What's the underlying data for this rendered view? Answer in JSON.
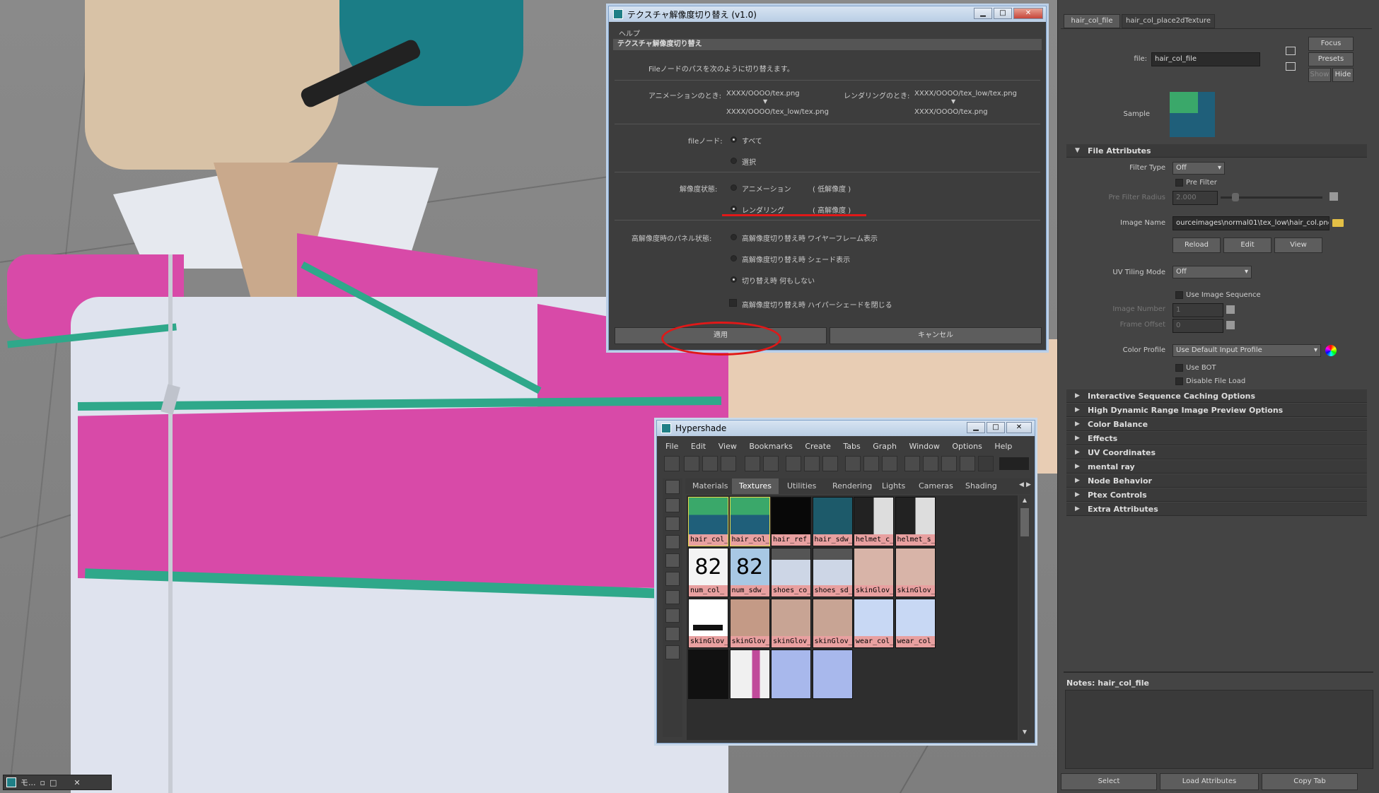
{
  "dialog": {
    "title": "テクスチャ解像度切り替え (v1.0)",
    "menu_help": "ヘルプ",
    "header": "テクスチャ解像度切り替え",
    "intro": "Fileノードのパスを次のように切り替えます。",
    "anim_label": "アニメーションのとき:",
    "anim_from": "XXXX/OOOO/tex.png",
    "anim_to": "XXXX/OOOO/tex_low/tex.png",
    "render_label": "レンダリングのとき:",
    "render_from": "XXXX/OOOO/tex_low/tex.png",
    "render_to": "XXXX/OOOO/tex.png",
    "file_node_label": "fileノード:",
    "opt_all": "すべて",
    "opt_selected": "選択",
    "res_state_label": "解像度状態:",
    "opt_animation": "アニメーション",
    "opt_animation_note": "( 低解像度 )",
    "opt_rendering": "レンダリング",
    "opt_rendering_note": "( 高解像度 )",
    "panel_state_label": "高解像度時のパネル状態:",
    "opt_wireframe": "高解像度切り替え時 ワイヤーフレーム表示",
    "opt_shaded": "高解像度切り替え時 シェード表示",
    "opt_nothing": "切り替え時 何もしない",
    "chk_close_hypershade": "高解像度切り替え時 ハイパーシェードを閉じる",
    "apply": "適用",
    "cancel": "キャンセル",
    "selected_file_node": "all",
    "selected_res": "rendering",
    "selected_panel": "nothing",
    "annotation_color": "#e01818"
  },
  "attribute_editor": {
    "tabs": [
      "hair_col_file",
      "hair_col_place2dTexture"
    ],
    "active_tab": "hair_col_file",
    "focus": "Focus",
    "presets": "Presets",
    "show": "Show",
    "hide": "Hide",
    "file_label": "file:",
    "file_value": "hair_col_file",
    "sample_label": "Sample",
    "file_attributes": "File Attributes",
    "filter_type_label": "Filter Type",
    "filter_type_value": "Off",
    "pre_filter": "Pre Filter",
    "pre_filter_radius_label": "Pre Filter Radius",
    "pre_filter_radius_value": "2.000",
    "image_name_label": "Image Name",
    "image_name_value": "ourceimages\\normal01\\tex_low\\hair_col.png",
    "reload": "Reload",
    "edit": "Edit",
    "view": "View",
    "uv_tiling_label": "UV Tiling Mode",
    "uv_tiling_value": "Off",
    "use_image_sequence": "Use Image Sequence",
    "image_number_label": "Image Number",
    "image_number_value": "1",
    "frame_offset_label": "Frame Offset",
    "frame_offset_value": "0",
    "color_profile_label": "Color Profile",
    "color_profile_value": "Use Default Input Profile",
    "use_bot": "Use BOT",
    "disable_file_load": "Disable File Load",
    "sections": [
      "Interactive Sequence Caching Options",
      "High Dynamic Range Image Preview Options",
      "Color Balance",
      "Effects",
      "UV Coordinates",
      "mental ray",
      "Node Behavior",
      "Ptex Controls",
      "Extra Attributes"
    ],
    "notes_label": "Notes:  hair_col_file",
    "select": "Select",
    "load_attributes": "Load Attributes",
    "copy_tab": "Copy Tab"
  },
  "hypershade": {
    "title": "Hypershade",
    "menu": [
      "File",
      "Edit",
      "View",
      "Bookmarks",
      "Create",
      "Tabs",
      "Graph",
      "Window",
      "Options",
      "Help"
    ],
    "tabs": [
      "Materials",
      "Textures",
      "Utilities",
      "Rendering",
      "Lights",
      "Cameras",
      "Shading Grc"
    ],
    "active_tab": "Textures",
    "swatches": [
      {
        "label": "hair_col_",
        "kind": "hair"
      },
      {
        "label": "hair_col_",
        "kind": "hair"
      },
      {
        "label": "hair_ref_",
        "kind": "black"
      },
      {
        "label": "hair_sdw_",
        "kind": "teal"
      },
      {
        "label": "helmet_c_",
        "kind": "helmet"
      },
      {
        "label": "helmet_s_",
        "kind": "helmet"
      },
      {
        "label": "num_col_",
        "kind": "num",
        "text": "82"
      },
      {
        "label": "num_sdw_",
        "kind": "num2",
        "text": "82"
      },
      {
        "label": "shoes_co_",
        "kind": "shoes"
      },
      {
        "label": "shoes_sd_",
        "kind": "shoes"
      },
      {
        "label": "skinGlov_",
        "kind": "skin"
      },
      {
        "label": "skinGlov_",
        "kind": "skin"
      },
      {
        "label": "skinGlov_",
        "kind": "bar"
      },
      {
        "label": "skinGlov_",
        "kind": "flat"
      },
      {
        "label": "skinGlov_",
        "kind": "skin2"
      },
      {
        "label": "skinGlov_",
        "kind": "skin2"
      },
      {
        "label": "wear_col_",
        "kind": "wear"
      },
      {
        "label": "wear_col_",
        "kind": "wear"
      },
      {
        "label": "",
        "kind": "black2"
      },
      {
        "label": "",
        "kind": "stripe"
      },
      {
        "label": "",
        "kind": "wear2"
      },
      {
        "label": "",
        "kind": "wear2"
      }
    ]
  },
  "mini_window": {
    "label": "モ..."
  }
}
